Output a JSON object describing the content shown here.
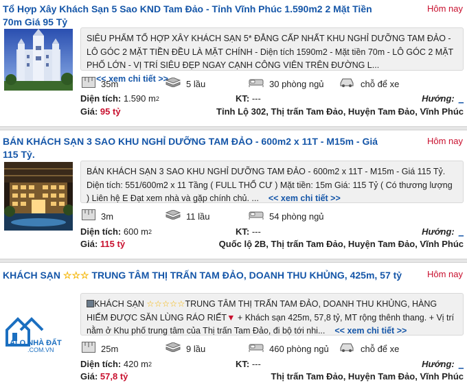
{
  "listings": [
    {
      "title": "Tổ Hợp Xây Khách Sạn 5 Sao KND Tam Đảo - Tỉnh Vĩnh Phúc 1.590m2 2 Mặt Tiền 70m Giá 95 Tỷ",
      "date": "Hôm nay",
      "description": "SIÊU PHẨM TỔ HỢP XÂY KHÁCH SẠN 5* ĐẲNG CẤP NHẤT KHU NGHỈ DƯỠNG TAM ĐẢO - LÔ GÓC 2 MẶT TIỀN ĐỀU LÀ MẶT CHÍNH - Diện tích 1590m2 - Mặt tiền 70m - LÔ GÓC 2 MẶT PHỐ LỚN - VỊ TRÍ SIÊU ĐẸP NGAY CẠNH CÔNG VIÊN TRÊN ĐƯỜNG L...",
      "more_label": "<< xem chi tiết >>",
      "frontage": "35m",
      "floors": "5 lầu",
      "bedrooms": "30 phòng ngủ",
      "parking": "chỗ để xe",
      "area_label": "Diện tích:",
      "area": "1.590 m",
      "area_sup": "2",
      "kt_label": "KT:",
      "kt": "---",
      "direction_label": "Hướng:",
      "direction": "_",
      "price_label": "Giá:",
      "price": "95 tỷ",
      "address": "Tỉnh Lộ 302, Thị trấn Tam Đảo, Huyện Tam Đảo, Vĩnh Phúc"
    },
    {
      "title": "BÁN KHÁCH SẠN 3 SAO KHU NGHỈ DƯỠNG TAM ĐẢO - 600m2 x 11T - M15m - Giá 115 Tỷ.",
      "date": "Hôm nay",
      "description": "BÁN KHÁCH SẠN 3 SAO KHU NGHỈ DƯỠNG TAM ĐẢO - 600m2 x 11T - M15m - Giá 115 Tỷ. Diện tích: 551/600m2 x 11 Tầng ( FULL THỔ CƯ ) Mặt tiền: 15m Giá: 115 Tỷ ( Có thương lượng ) Liên hệ E Đạt xem nhà và gặp chính chủ. ...",
      "more_label": "<< xem chi tiết >>",
      "frontage": "3m",
      "floors": "11 lầu",
      "bedrooms": "54 phòng ngủ",
      "area_label": "Diện tích:",
      "area": "600 m",
      "area_sup": "2",
      "kt_label": "KT:",
      "kt": "---",
      "direction_label": "Hướng:",
      "direction": "_",
      "price_label": "Giá:",
      "price": "115 tỷ",
      "address": "Quốc lộ 2B, Thị trấn Tam Đảo, Huyện Tam Đảo, Vĩnh Phúc"
    },
    {
      "title_pre": "KHÁCH SẠN",
      "title_stars": "☆☆☆",
      "title_post": "TRUNG TÂM THỊ TRẤN TAM ĐẢO, DOANH THU KHỦNG, 425m, 57 tỷ",
      "date": "Hôm nay",
      "desc_pre": "KHÁCH SẠN",
      "desc_stars": "☆☆☆☆☆",
      "desc_post": "TRUNG TÂM THỊ TRẤN TAM ĐẢO, DOANH THU KHỦNG, HÀNG HIẾM ĐƯỢC SĂN LÙNG RÁO RIẾT",
      "desc_rest": "+ Khách sạn 425m, 57,8 tỷ, MT rộng thênh thang. + Vị trí nằm ở Khu phố trung tâm của Thị trấn Tam Đảo, đi bộ tới nhi...",
      "more_label": "<< xem chi tiết >>",
      "logo_text": "ALO NHÀ ĐẤT",
      "logo_sub": ".COM.VN",
      "frontage": "25m",
      "floors": "9 lầu",
      "bedrooms": "460 phòng ngủ",
      "parking": "chỗ để xe",
      "area_label": "Diện tích:",
      "area": "420 m",
      "area_sup": "2",
      "kt_label": "KT:",
      "kt": "---",
      "direction_label": "Hướng:",
      "direction": "_",
      "price_label": "Giá:",
      "price": "57,8 tỷ",
      "address": "Thị trấn Tam Đảo, Huyện Tam Đảo, Vĩnh Phúc"
    }
  ],
  "colors": {
    "link": "#1556a8",
    "accent_red": "#c8102e",
    "desc_bg": "#f0f0f0"
  },
  "icons": [
    "ruler-icon",
    "floors-icon",
    "bed-icon",
    "car-icon"
  ]
}
